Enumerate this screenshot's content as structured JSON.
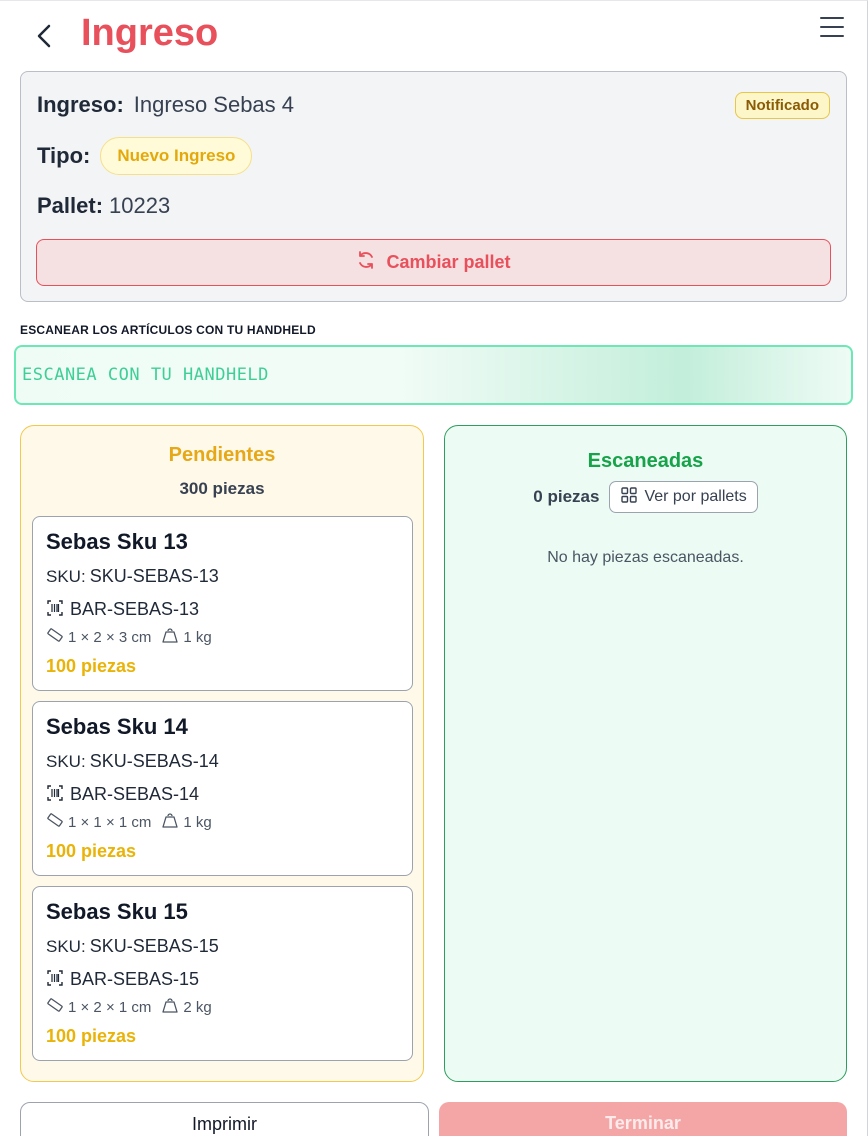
{
  "header": {
    "title": "Ingreso"
  },
  "info": {
    "ingreso_label": "Ingreso:",
    "ingreso_value": "Ingreso Sebas 4",
    "status_badge": "Notificado",
    "tipo_label": "Tipo:",
    "tipo_value": "Nuevo Ingreso",
    "pallet_label": "Pallet:",
    "pallet_value": "10223",
    "change_pallet_label": "Cambiar pallet"
  },
  "scanner": {
    "label": "ESCANEAR LOS ARTÍCULOS CON TU HANDHELD",
    "placeholder": "ESCANEA CON TU HANDHELD"
  },
  "pending": {
    "title": "Pendientes",
    "count": "300 piezas",
    "items": [
      {
        "name": "Sebas Sku 13",
        "sku_label": "SKU:",
        "sku": "SKU-SEBAS-13",
        "barcode": "BAR-SEBAS-13",
        "dims": "1 × 2 × 3 cm",
        "weight": "1 kg",
        "qty": "100 piezas"
      },
      {
        "name": "Sebas Sku 14",
        "sku_label": "SKU:",
        "sku": "SKU-SEBAS-14",
        "barcode": "BAR-SEBAS-14",
        "dims": "1 × 1 × 1 cm",
        "weight": "1 kg",
        "qty": "100 piezas"
      },
      {
        "name": "Sebas Sku 15",
        "sku_label": "SKU:",
        "sku": "SKU-SEBAS-15",
        "barcode": "BAR-SEBAS-15",
        "dims": "1 × 2 × 1 cm",
        "weight": "2 kg",
        "qty": "100 piezas"
      }
    ]
  },
  "scanned": {
    "title": "Escaneadas",
    "count": "0 piezas",
    "view_pallets_label": "Ver por pallets",
    "empty_text": "No hay piezas escaneadas."
  },
  "footer": {
    "print_label": "Imprimir",
    "finish_label": "Terminar"
  },
  "colors": {
    "brand": "#e8505b",
    "pending_accent": "#e6a817",
    "scanned_accent": "#16a34a",
    "scanner_border": "#6ee7b7"
  },
  "icons": [
    "back-arrow-icon",
    "hamburger-menu-icon",
    "refresh-icon",
    "grid-icon",
    "barcode-icon",
    "ruler-icon",
    "weight-icon"
  ]
}
